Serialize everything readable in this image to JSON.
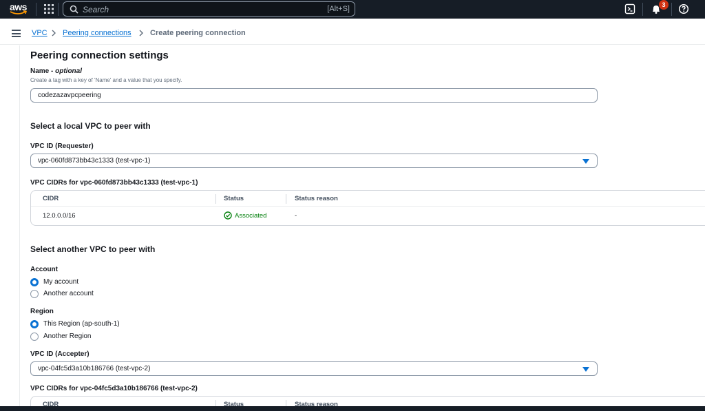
{
  "topnav": {
    "logo_text": "aws",
    "search_placeholder": "Search",
    "search_shortcut": "[Alt+S]",
    "notification_count": "3"
  },
  "breadcrumb": {
    "items": [
      "VPC",
      "Peering connections",
      "Create peering connection"
    ]
  },
  "section": {
    "title": "Peering connection settings",
    "name_label": "Name - ",
    "name_optional": "optional",
    "name_description": "Create a tag with a key of 'Name' and a value that you specify.",
    "name_value": "codezazavpcpeering"
  },
  "local": {
    "heading": "Select a local VPC to peer with",
    "vpc_id_label": "VPC ID (Requester)",
    "vpc_id_value": "vpc-060fd873bb43c1333 (test-vpc-1)",
    "cidrs_label": "VPC CIDRs for vpc-060fd873bb43c1333 (test-vpc-1)",
    "table": {
      "headers": [
        "CIDR",
        "Status",
        "Status reason"
      ],
      "rows": [
        {
          "cidr": "12.0.0.0/16",
          "status": "Associated",
          "reason": "-"
        }
      ]
    }
  },
  "remote": {
    "heading": "Select another VPC to peer with",
    "account_label": "Account",
    "account_options": [
      "My account",
      "Another account"
    ],
    "account_selected": "My account",
    "region_label": "Region",
    "region_options": [
      "This Region (ap-south-1)",
      "Another Region"
    ],
    "region_selected": "This Region (ap-south-1)",
    "vpc_id_label": "VPC ID (Accepter)",
    "vpc_id_value": "vpc-04fc5d3a10b186766 (test-vpc-2)",
    "cidrs_label": "VPC CIDRs for vpc-04fc5d3a10b186766 (test-vpc-2)",
    "table_headers": [
      "CIDR",
      "Status",
      "Status reason"
    ]
  },
  "colors": {
    "nav_bg": "#161d26",
    "link": "#0972d3",
    "success": "#037f0c",
    "badge": "#d13212"
  }
}
